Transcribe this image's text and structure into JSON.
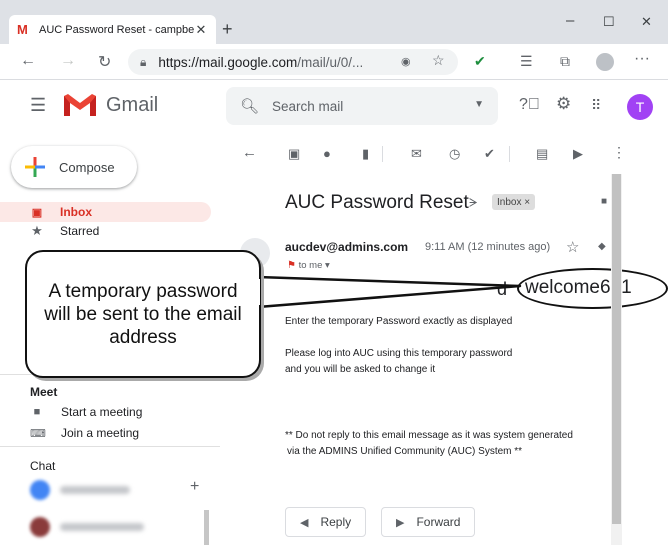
{
  "browser": {
    "tab_title": "AUC Password Reset - campbellt",
    "tab_favicon": "M",
    "tab_close": "✕",
    "new_tab": "+",
    "window_controls": {
      "minimize": "–",
      "maximize": "☐",
      "close": "✕"
    },
    "url_domain": "https://mail.google.com",
    "url_path": "/mail/u/0/..."
  },
  "gmail": {
    "app_name": "Gmail",
    "search_placeholder": "Search mail",
    "avatar_letter": "T"
  },
  "sidebar": {
    "compose_label": "Compose",
    "nav_items": [
      {
        "label": "Inbox",
        "active": true
      },
      {
        "label": "Starred",
        "active": false
      }
    ],
    "meet_heading": "Meet",
    "meet_items": [
      "Start a meeting",
      "Join a meeting"
    ],
    "chat_heading": "Chat",
    "chat_add": "+"
  },
  "email": {
    "subject": "AUC Password Reset",
    "label_chip": "Inbox ×",
    "sender": "aucdev@admins.com",
    "timestamp": "9:11 AM (12 minutes ago)",
    "recipient": "to me ▾",
    "password": "welcome661",
    "body_partial_char": "d",
    "body_lines": [
      "Enter the temporary Password exactly as displayed",
      "Please log into AUC using this temporary password",
      "and you will be asked to change it",
      "** Do not reply to this email message as it was system generated",
      "via the ADMINS Unified Community (AUC) System **"
    ],
    "reply_label": "Reply",
    "forward_label": "Forward"
  },
  "annotation": {
    "callout_text": "A temporary password will be sent to the email address"
  },
  "colors": {
    "gmail_red": "#d93025",
    "avatar_purple": "#a142f4",
    "active_nav_bg": "#fce8e6"
  }
}
